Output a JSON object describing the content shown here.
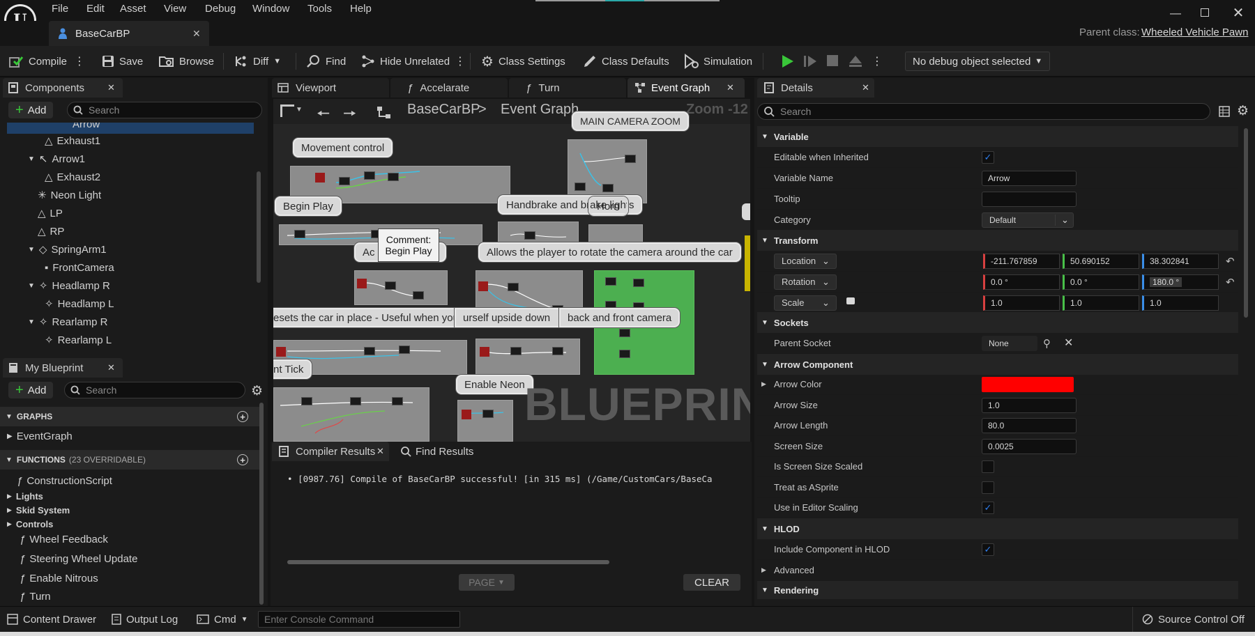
{
  "menu": {
    "items": [
      "File",
      "Edit",
      "Asset",
      "View",
      "Debug",
      "Window",
      "Tools",
      "Help"
    ]
  },
  "window": {
    "doc_tab": "BaseCarBP",
    "parent_class_label": "Parent class:",
    "parent_class_value": "Wheeled Vehicle Pawn"
  },
  "toolbar": {
    "compile": "Compile",
    "save": "Save",
    "browse": "Browse",
    "diff": "Diff",
    "find": "Find",
    "hide_unrelated": "Hide Unrelated",
    "class_settings": "Class Settings",
    "class_defaults": "Class Defaults",
    "simulation": "Simulation",
    "debug_object": "No debug object selected"
  },
  "components": {
    "tab": "Components",
    "add": "Add",
    "search_placeholder": "Search",
    "items": [
      {
        "label": "Arrow"
      },
      {
        "label": "Exhaust1"
      },
      {
        "label": "Arrow1"
      },
      {
        "label": "Exhaust2"
      },
      {
        "label": "Neon Light"
      },
      {
        "label": "LP"
      },
      {
        "label": "RP"
      },
      {
        "label": "SpringArm1"
      },
      {
        "label": "FrontCamera"
      },
      {
        "label": "Headlamp R"
      },
      {
        "label": "Headlamp L"
      },
      {
        "label": "Rearlamp R"
      },
      {
        "label": "Rearlamp L"
      }
    ]
  },
  "my_blueprint": {
    "tab": "My Blueprint",
    "add": "Add",
    "search_placeholder": "Search",
    "graphs_header": "GRAPHS",
    "event_graph": "EventGraph",
    "functions_header": "FUNCTIONS",
    "functions_count": "(23 OVERRIDABLE)",
    "functions": [
      "ConstructionScript"
    ],
    "categories": [
      "Lights",
      "Skid System",
      "Controls"
    ],
    "controls_items": [
      "Wheel Feedback",
      "Steering Wheel Update",
      "Enable Nitrous",
      "Turn"
    ]
  },
  "graph": {
    "tabs": [
      "Viewport",
      "Accelarate",
      "Turn",
      "Event Graph"
    ],
    "breadcrumb_bp": "BaseCarBP",
    "breadcrumb_sep": ">",
    "breadcrumb_graph": "Event Graph",
    "zoom": "Zoom -12",
    "watermark": "BLUEPRINT",
    "comments": {
      "main_camera": "MAIN CAMERA ZOOM",
      "movement": "Movement control",
      "begin_play": "Begin Play",
      "handbrake": "Handbrake and brake lights",
      "horn": "Horn",
      "ac_lamps": "Ac               mps",
      "allows": "Allows the player to rotate the camera around the car",
      "resets": "esets the car in place - Useful when you find yo",
      "switches": "urself upside down",
      "back_front": "back and front camera",
      "event_tick": "nt Tick",
      "enable_neon": "Enable Neon"
    },
    "tooltip_line1": "Comment:",
    "tooltip_line2": "Begin Play"
  },
  "compiler": {
    "tab": "Compiler Results",
    "find_tab": "Find Results",
    "message": "[0987.76] Compile of BaseCarBP successful! [in 315 ms] (/Game/CustomCars/BaseCa",
    "page": "PAGE",
    "clear": "CLEAR"
  },
  "details": {
    "tab": "Details",
    "search_placeholder": "Search",
    "variable_section": "Variable",
    "editable_label": "Editable when Inherited",
    "editable_checked": true,
    "varname_label": "Variable Name",
    "varname_value": "Arrow",
    "tooltip_label": "Tooltip",
    "tooltip_value": "",
    "category_label": "Category",
    "category_value": "Default",
    "transform_section": "Transform",
    "location_label": "Location",
    "location": [
      "-211.767859",
      "50.690152",
      "38.302841"
    ],
    "rotation_label": "Rotation",
    "rotation": [
      "0.0 °",
      "0.0 °",
      "180.0 °"
    ],
    "scale_label": "Scale",
    "scale": [
      "1.0",
      "1.0",
      "1.0"
    ],
    "sockets_section": "Sockets",
    "parent_socket_label": "Parent Socket",
    "parent_socket_value": "None",
    "arrow_section": "Arrow Component",
    "arrow_color_label": "Arrow Color",
    "arrow_color": "#ff0000",
    "arrow_size_label": "Arrow Size",
    "arrow_size": "1.0",
    "arrow_length_label": "Arrow Length",
    "arrow_length": "80.0",
    "screen_size_label": "Screen Size",
    "screen_size": "0.0025",
    "screen_scaled_label": "Is Screen Size Scaled",
    "treat_sprite_label": "Treat as ASprite",
    "editor_scaling_label": "Use in Editor Scaling",
    "hlod_section": "HLOD",
    "include_hlod_label": "Include Component in HLOD",
    "advanced_label": "Advanced",
    "rendering_section": "Rendering"
  },
  "status": {
    "content_drawer": "Content Drawer",
    "output_log": "Output Log",
    "cmd": "Cmd",
    "console_placeholder": "Enter Console Command",
    "source_control": "Source Control Off"
  },
  "colors": {
    "accent_green": "#39c639",
    "link_blue": "#4fa0ff",
    "checkbox_blue": "#2f7ff0"
  }
}
